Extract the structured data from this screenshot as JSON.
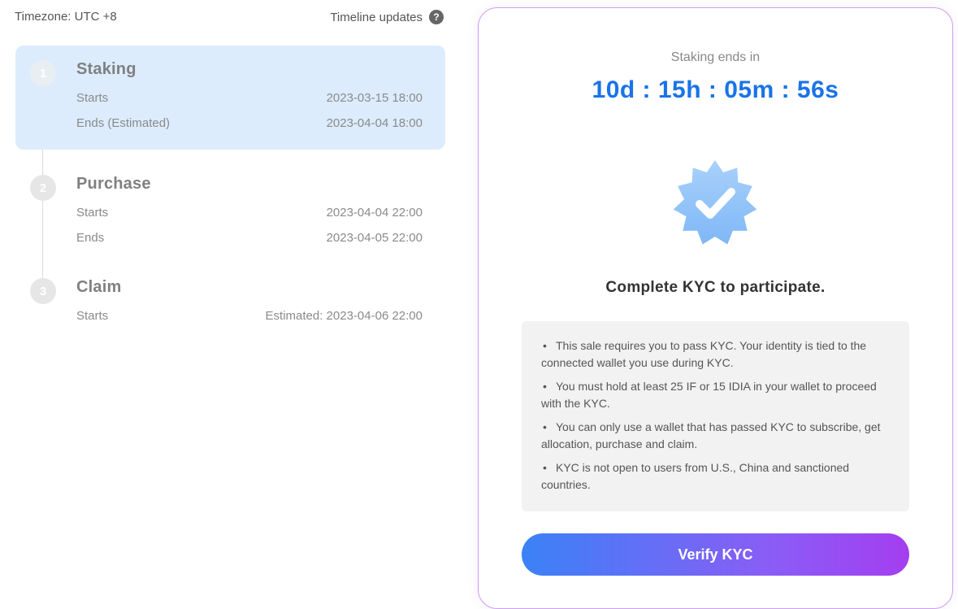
{
  "header": {
    "timezone": "Timezone: UTC +8",
    "timeline_updates": "Timeline updates"
  },
  "stages": [
    {
      "number": "1",
      "title": "Staking",
      "rows": [
        {
          "label": "Starts",
          "value": "2023-03-15 18:00"
        },
        {
          "label": "Ends (Estimated)",
          "value": "2023-04-04 18:00"
        }
      ]
    },
    {
      "number": "2",
      "title": "Purchase",
      "rows": [
        {
          "label": "Starts",
          "value": "2023-04-04 22:00"
        },
        {
          "label": "Ends",
          "value": "2023-04-05 22:00"
        }
      ]
    },
    {
      "number": "3",
      "title": "Claim",
      "rows": [
        {
          "label": "Starts",
          "value": "Estimated: 2023-04-06 22:00"
        }
      ]
    }
  ],
  "card": {
    "ends_label": "Staking ends in",
    "countdown": "10d : 15h : 05m : 56s",
    "badge_icon": "verified-badge-icon",
    "kyc_title": "Complete KYC to participate.",
    "info": [
      "This sale requires you to pass KYC. Your identity is tied to the connected wallet you use during KYC.",
      "You must hold at least 25 IF or 15 IDIA in your wallet to proceed with the KYC.",
      "You can only use a wallet that has passed KYC to subscribe, get allocation, purchase and claim.",
      "KYC is not open to users from U.S., China and sanctioned countries."
    ],
    "verify_button": "Verify KYC"
  },
  "colors": {
    "accent": "#1a73e8",
    "active_stage_bg": "#dcecfd",
    "button_gradient_start": "#3b82f6",
    "button_gradient_end": "#a43ef0"
  }
}
